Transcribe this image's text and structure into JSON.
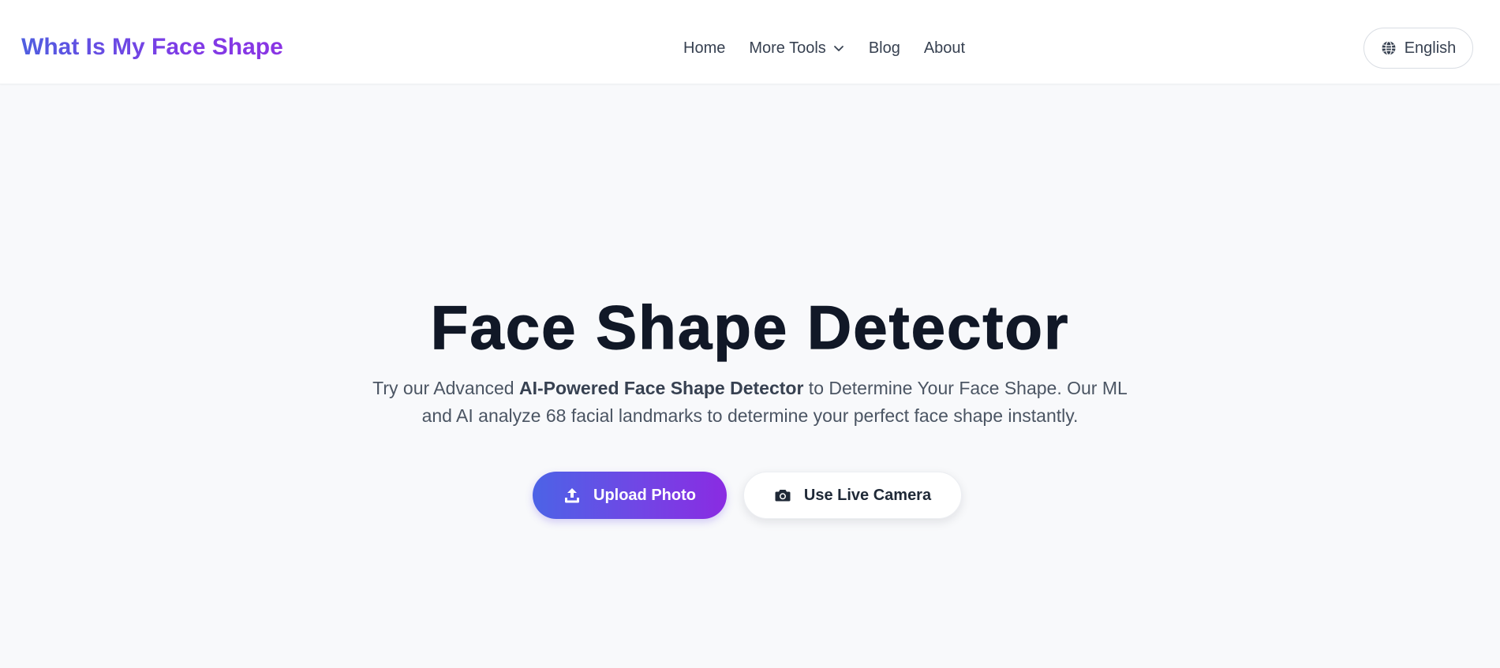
{
  "header": {
    "logo": "What Is My Face Shape",
    "nav": {
      "home": "Home",
      "more_tools": "More Tools",
      "blog": "Blog",
      "about": "About"
    },
    "language": "English"
  },
  "hero": {
    "title": "Face Shape Detector",
    "subtitle_prefix": "Try our Advanced ",
    "subtitle_bold": "AI-Powered Face Shape Detector",
    "subtitle_suffix": " to Determine Your Face Shape. Our ML and AI analyze 68 facial landmarks to determine your perfect face shape instantly.",
    "upload_button": "Upload Photo",
    "camera_button": "Use Live Camera"
  },
  "icons": {
    "nav_dropdown": "chevron-down-icon",
    "language": "globe-icon",
    "upload": "upload-icon",
    "camera": "camera-icon"
  },
  "colors": {
    "brand_gradient_start": "#4f5ee0",
    "brand_gradient_end": "#8a34e4",
    "title": "#111827",
    "text": "#374151",
    "page_background": "#f8f9fb"
  }
}
